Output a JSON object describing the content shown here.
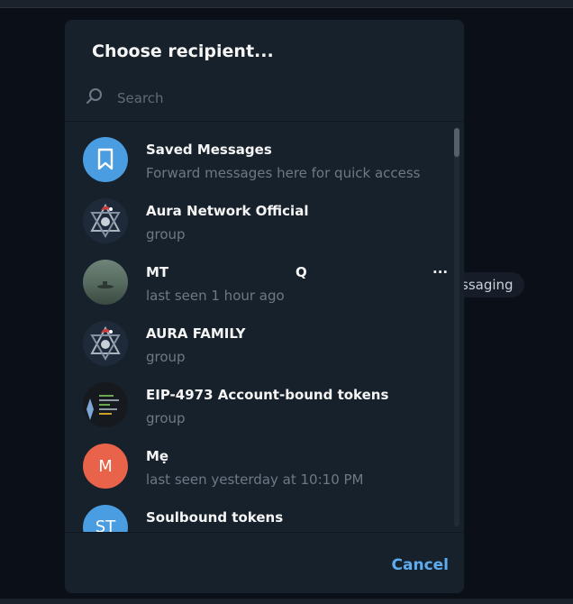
{
  "background": {
    "pill_text": "ssaging"
  },
  "dialog": {
    "title": "Choose recipient...",
    "search_placeholder": "Search",
    "cancel_label": "Cancel",
    "accent_color": "#5eabef"
  },
  "recipients": [
    {
      "name": "Saved Messages",
      "subtitle": "Forward messages here for quick access",
      "avatar_icon": "bookmark-icon",
      "avatar_color": "#4a9de0"
    },
    {
      "name": "Aura Network Official",
      "subtitle": "group",
      "avatar_icon": "aura-logo-icon"
    },
    {
      "name": "MT",
      "name_extra": "Q",
      "name_suffix": "...",
      "subtitle": "last seen 1 hour ago",
      "avatar_icon": "photo-avatar"
    },
    {
      "name": "AURA FAMILY",
      "subtitle": "group",
      "avatar_icon": "aura-logo-icon"
    },
    {
      "name": "EIP-4973 Account-bound tokens",
      "subtitle": "group",
      "avatar_icon": "code-screenshot-avatar"
    },
    {
      "name": "Mẹ",
      "subtitle": "last seen yesterday at 10:10 PM",
      "avatar_initials": "M",
      "avatar_color": "#e8634a"
    },
    {
      "name": "Soulbound tokens",
      "subtitle": "",
      "avatar_initials": "ST",
      "avatar_color": "#4a9de0"
    }
  ]
}
